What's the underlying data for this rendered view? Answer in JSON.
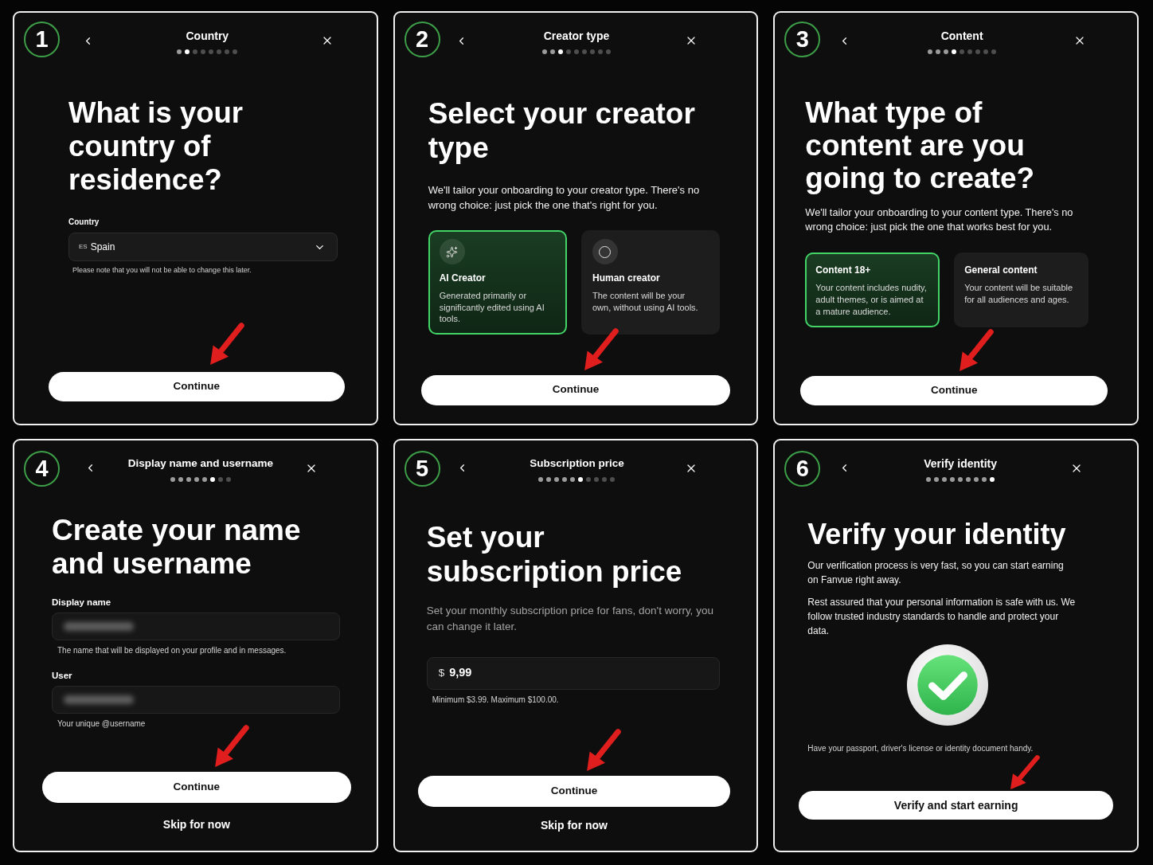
{
  "panels": [
    {
      "number": "1",
      "title": "Country",
      "steps": [
        {
          "selected": false,
          "completed": true
        },
        {
          "selected": true,
          "completed": false
        },
        {
          "selected": false,
          "completed": false
        },
        {
          "selected": false,
          "completed": false
        },
        {
          "selected": false,
          "completed": false
        },
        {
          "selected": false,
          "completed": false
        },
        {
          "selected": false,
          "completed": false
        },
        {
          "selected": false,
          "completed": false
        }
      ],
      "heading": "What is your country of residence?",
      "blocks": [
        {
          "kind": "select",
          "label": "Country",
          "flag": "ES",
          "value": "Spain",
          "hint": "Please note that you will not be able to change this later."
        }
      ],
      "actions": [
        {
          "kind": "primary",
          "label": "Continue"
        }
      ]
    },
    {
      "number": "2",
      "title": "Creator type",
      "steps": [
        {
          "selected": false,
          "completed": true
        },
        {
          "selected": false,
          "completed": true
        },
        {
          "selected": true,
          "completed": false
        },
        {
          "selected": false,
          "completed": false
        },
        {
          "selected": false,
          "completed": false
        },
        {
          "selected": false,
          "completed": false
        },
        {
          "selected": false,
          "completed": false
        },
        {
          "selected": false,
          "completed": false
        },
        {
          "selected": false,
          "completed": false
        }
      ],
      "heading": "Select your creator type",
      "blocks": [
        {
          "kind": "paragraph",
          "muted": false,
          "text": "We'll tailor your onboarding to your creator type. There's no wrong choice: just pick the one that's right for you."
        },
        {
          "kind": "options",
          "icons": true,
          "items": [
            {
              "title": "AI Creator",
              "description": "Generated primarily or significantly edited using AI tools.",
              "selected": true
            },
            {
              "title": "Human creator",
              "description": "The content will be your own, without using AI tools.",
              "selected": false
            }
          ]
        }
      ],
      "actions": [
        {
          "kind": "primary",
          "label": "Continue"
        }
      ]
    },
    {
      "number": "3",
      "title": "Content",
      "steps": [
        {
          "selected": false,
          "completed": true
        },
        {
          "selected": false,
          "completed": true
        },
        {
          "selected": false,
          "completed": true
        },
        {
          "selected": true,
          "completed": false
        },
        {
          "selected": false,
          "completed": false
        },
        {
          "selected": false,
          "completed": false
        },
        {
          "selected": false,
          "completed": false
        },
        {
          "selected": false,
          "completed": false
        },
        {
          "selected": false,
          "completed": false
        }
      ],
      "heading": "What type of content are you going to create?",
      "blocks": [
        {
          "kind": "paragraph",
          "muted": false,
          "text": "We'll tailor your onboarding to your content type. There's no wrong choice: just pick the one that works best for you."
        },
        {
          "kind": "options",
          "items": [
            {
              "title": "Content 18+",
              "description": "Your content includes nudity, adult themes, or is aimed at a mature audience.",
              "selected": true
            },
            {
              "title": "General content",
              "description": "Your content will be suitable for all audiences and ages.",
              "selected": false
            }
          ]
        }
      ],
      "actions": [
        {
          "kind": "primary",
          "label": "Continue"
        }
      ]
    },
    {
      "number": "4",
      "title": "Display name and username",
      "steps": [
        {
          "selected": false,
          "completed": true
        },
        {
          "selected": false,
          "completed": true
        },
        {
          "selected": false,
          "completed": true
        },
        {
          "selected": false,
          "completed": true
        },
        {
          "selected": false,
          "completed": true
        },
        {
          "selected": true,
          "completed": false
        },
        {
          "selected": false,
          "completed": false
        },
        {
          "selected": false,
          "completed": false
        }
      ],
      "heading": "Create your name and username",
      "blocks": [
        {
          "kind": "text_field",
          "label": "Display name",
          "blurred": true,
          "hint": "The name that will be displayed on your profile and in messages."
        },
        {
          "kind": "text_field",
          "label": "User",
          "blurred": true,
          "hint": "Your unique @username"
        }
      ],
      "actions": [
        {
          "kind": "primary",
          "label": "Continue"
        },
        {
          "kind": "link",
          "label": "Skip for now"
        }
      ]
    },
    {
      "number": "5",
      "title": "Subscription price",
      "steps": [
        {
          "selected": false,
          "completed": true
        },
        {
          "selected": false,
          "completed": true
        },
        {
          "selected": false,
          "completed": true
        },
        {
          "selected": false,
          "completed": true
        },
        {
          "selected": false,
          "completed": true
        },
        {
          "selected": true,
          "completed": false
        },
        {
          "selected": false,
          "completed": false
        },
        {
          "selected": false,
          "completed": false
        },
        {
          "selected": false,
          "completed": false
        },
        {
          "selected": false,
          "completed": false
        }
      ],
      "heading": "Set your subscription price",
      "blocks": [
        {
          "kind": "paragraph",
          "muted": true,
          "text": "Set your monthly subscription price for fans, don't worry, you can change it later."
        },
        {
          "kind": "price_field",
          "prefix": "$",
          "value": "9,99",
          "hint": "Minimum $3.99. Maximum $100.00."
        }
      ],
      "actions": [
        {
          "kind": "primary",
          "label": "Continue"
        },
        {
          "kind": "link",
          "label": "Skip for now"
        }
      ]
    },
    {
      "number": "6",
      "title": "Verify identity",
      "steps": [
        {
          "selected": false,
          "completed": true
        },
        {
          "selected": false,
          "completed": true
        },
        {
          "selected": false,
          "completed": true
        },
        {
          "selected": false,
          "completed": true
        },
        {
          "selected": false,
          "completed": true
        },
        {
          "selected": false,
          "completed": true
        },
        {
          "selected": false,
          "completed": true
        },
        {
          "selected": false,
          "completed": true
        },
        {
          "selected": true,
          "completed": false
        }
      ],
      "heading": "Verify your identity",
      "blocks": [
        {
          "kind": "paragraph",
          "muted": false,
          "text": "Our verification process is very fast, so you can start earning on Fanvue right away."
        },
        {
          "kind": "paragraph",
          "muted": false,
          "text": "Rest assured that your personal information is safe with us. We follow trusted industry standards to handle and protect your data."
        },
        {
          "kind": "check_illustration"
        },
        {
          "kind": "note",
          "text": "Have your passport, driver's license or identity document handy."
        }
      ],
      "actions": [
        {
          "kind": "primary",
          "label": "Verify and start earning"
        }
      ]
    }
  ]
}
